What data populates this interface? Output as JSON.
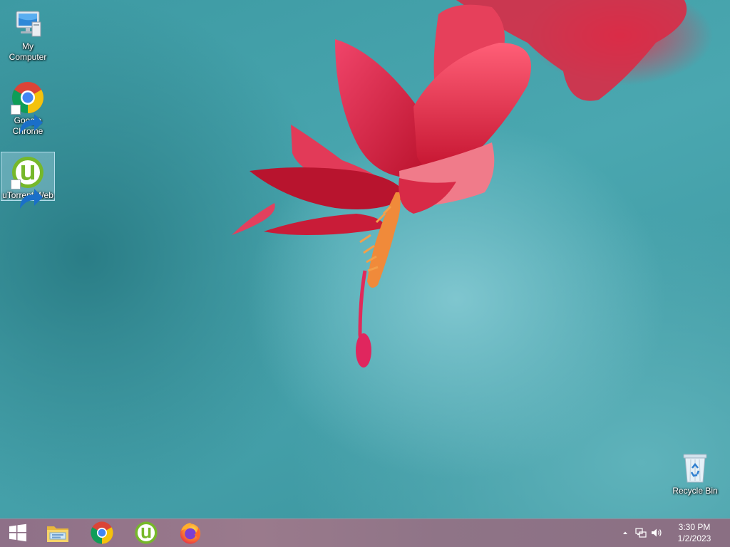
{
  "desktop": {
    "icons": [
      {
        "label": "My Computer",
        "icon": "computer-icon"
      },
      {
        "label": "Google Chrome",
        "icon": "chrome-icon",
        "shortcut": true
      },
      {
        "label": "uTorrent Web",
        "icon": "utorrent-icon",
        "shortcut": true,
        "selected": true
      },
      {
        "label": "Recycle Bin",
        "icon": "recycle-bin-icon"
      }
    ]
  },
  "taskbar": {
    "pinned": [
      {
        "name": "File Explorer",
        "icon": "file-explorer-icon"
      },
      {
        "name": "Google Chrome",
        "icon": "chrome-icon"
      },
      {
        "name": "uTorrent Web",
        "icon": "utorrent-icon"
      },
      {
        "name": "Firefox",
        "icon": "firefox-icon"
      }
    ],
    "tray": {
      "icons": [
        "show-hidden-icons-chevron",
        "network-icon",
        "volume-icon"
      ],
      "time": "3:30 PM",
      "date": "1/2/2023"
    }
  },
  "colors": {
    "wallpaper_teal": "#4aa7b0",
    "flower_red": "#d8203a",
    "taskbar": "#957588",
    "selection": "#bee1f0",
    "utorrent_green": "#76b82a"
  }
}
